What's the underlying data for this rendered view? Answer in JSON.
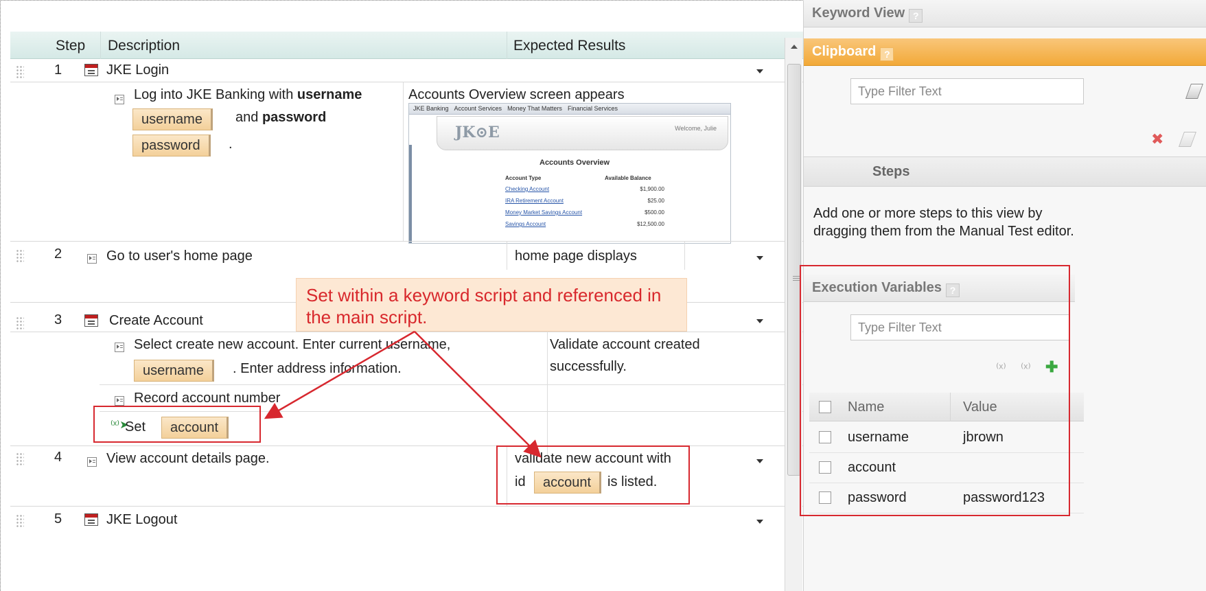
{
  "editor": {
    "columns": {
      "step": "Step",
      "description": "Description",
      "expected": "Expected Results"
    },
    "steps": [
      {
        "num": "1",
        "title": "JKE Login",
        "sub": [
          {
            "text_a": "Log into JKE Banking with ",
            "bold_a": "username",
            "chip_a": "username",
            "text_b": "and ",
            "bold_b": "password",
            "chip_b": "password",
            "end": ".",
            "expected": "Accounts Overview screen appears"
          }
        ]
      },
      {
        "num": "2",
        "title": "Go to user's home page",
        "expected": "home page displays"
      },
      {
        "num": "3",
        "title": "Create Account",
        "sub": [
          {
            "text_a": "Select create new account.  Enter current username,",
            "chip": "username",
            "text_b": ". Enter address information.",
            "expected_a": "Validate account created",
            "expected_b": "successfully."
          },
          {
            "text": "Record account number"
          },
          {
            "set_label": "Set",
            "chip": "account"
          }
        ]
      },
      {
        "num": "4",
        "title": "View account details page.",
        "expected_a": "validate new account with",
        "expected_id": "id",
        "expected_chip": "account",
        "expected_b": "is listed."
      },
      {
        "num": "5",
        "title": "JKE Logout"
      }
    ],
    "thumbnail": {
      "nav": [
        "JKE Banking",
        "Account Services",
        "Money That Matters",
        "Financial Services"
      ],
      "logo": "JK⊙E",
      "welcome": "Welcome, Julie",
      "title": "Accounts Overview",
      "col_type": "Account Type",
      "col_balance": "Available Balance",
      "accounts": [
        {
          "name": "Checking Account",
          "balance": "$1,900.00"
        },
        {
          "name": "IRA Retirement Account",
          "balance": "$25.00"
        },
        {
          "name": "Money Market Savings Account",
          "balance": "$500.00"
        },
        {
          "name": "Savings Account",
          "balance": "$12,500.00"
        }
      ]
    },
    "callout": "Set within a keyword script and referenced in the main script."
  },
  "panel": {
    "keyword_view": "Keyword View",
    "clipboard": "Clipboard",
    "filter_placeholder": "Type Filter Text",
    "steps_header": "Steps",
    "info": "Add one or more steps to this view by dragging them from the Manual Test editor.",
    "exec_vars": "Execution Variables",
    "exec_filter_placeholder": "Type Filter Text",
    "table": {
      "name_col": "Name",
      "value_col": "Value",
      "rows": [
        {
          "name": "username",
          "value": "jbrown"
        },
        {
          "name": "account",
          "value": ""
        },
        {
          "name": "password",
          "value": "password123"
        }
      ]
    },
    "help": "?"
  },
  "colors": {
    "accent_orange": "#f2a938",
    "annotation_red": "#d7282f",
    "chip": "#f3d09a"
  }
}
